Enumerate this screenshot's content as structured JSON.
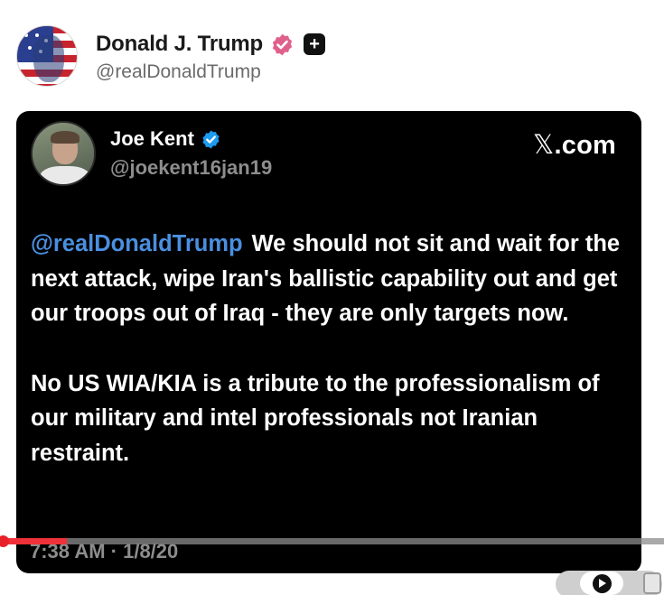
{
  "post": {
    "author_name": "Donald J. Trump",
    "author_handle": "@realDonaldTrump"
  },
  "embedded_tweet": {
    "author_name": "Joe Kent",
    "author_handle": "@joekent16jan19",
    "source": ".com",
    "source_prefix_glyph": "𝕏",
    "mention": "@realDonaldTrump",
    "paragraph_1_rest": "We should not sit and wait for the next attack, wipe Iran's ballistic capability out and get our troops out of Iraq - they are only targets now.",
    "paragraph_2": "No US WIA/KIA is a tribute to the professionalism of our military and intel professionals not Iranian restraint.",
    "timestamp": "7:38 AM · 1/8/20"
  },
  "video_player": {
    "progress_fraction": 0.1,
    "accent_color": "#f0313a"
  },
  "colors": {
    "verified_pink": "#e0608c",
    "verified_blue": "#1d9bf0",
    "mention_blue": "#4a8fe0",
    "card_background": "#000000"
  },
  "icons": {
    "author_badge": "verified-badge-pink",
    "extra_badge": "plus-square-icon",
    "tweet_badge": "verified-badge-blue",
    "play": "play-icon"
  }
}
